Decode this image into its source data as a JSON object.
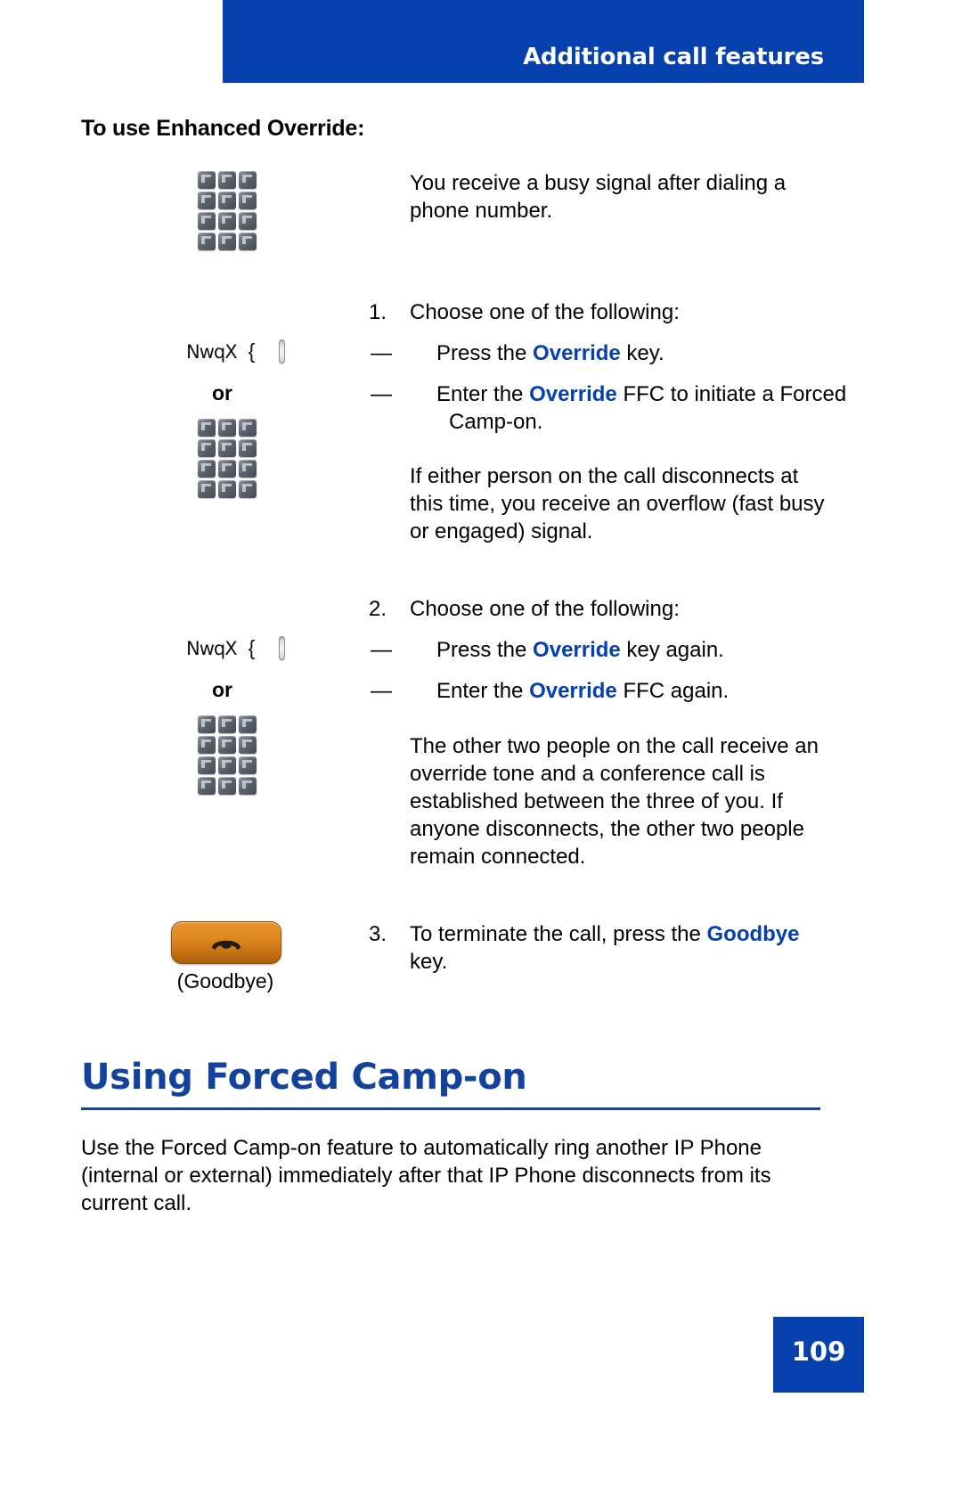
{
  "header": {
    "title": "Additional call features",
    "banner_color": "#0540AC"
  },
  "section": {
    "title": "To use Enhanced Override:"
  },
  "intro": {
    "text": "You receive a busy signal after dialing a phone number."
  },
  "steps": [
    {
      "number": "1.",
      "text": "Choose one of the following:",
      "options": [
        {
          "dash": "—",
          "pre": "Press the ",
          "keyword": "Override",
          "post": " key."
        },
        {
          "dash": "—",
          "pre": "Enter the ",
          "keyword": "Override",
          "post": " FFC to initiate a Forced Camp-on."
        }
      ],
      "note": "If either person on the call disconnects at this time, you receive an overflow (fast busy or engaged) signal.",
      "key_label": "NwqX",
      "key_brace": "{",
      "or_label": "or"
    },
    {
      "number": "2.",
      "text": "Choose one of the following:",
      "options": [
        {
          "dash": "—",
          "pre": "Press the ",
          "keyword": "Override",
          "post": " key again."
        },
        {
          "dash": "—",
          "pre": "Enter the ",
          "keyword": "Override",
          "post": " FFC again."
        }
      ],
      "note": "The other two people on the call receive an override tone and a conference call is established between the three of you. If anyone disconnects, the other two people remain connected.",
      "key_label": "NwqX",
      "key_brace": "{",
      "or_label": "or"
    },
    {
      "number": "3.",
      "pre": "To terminate the call, press the ",
      "keyword": "Goodbye",
      "post": " key.",
      "caption": "(Goodbye)"
    }
  ],
  "chapter": {
    "heading": "Using Forced Camp-on",
    "heading_color": "#12429C",
    "lead": "Use the Forced Camp-on feature to automatically ring another IP Phone (internal or external) immediately after that IP Phone disconnects from its current call."
  },
  "footer": {
    "page_number": "109"
  }
}
